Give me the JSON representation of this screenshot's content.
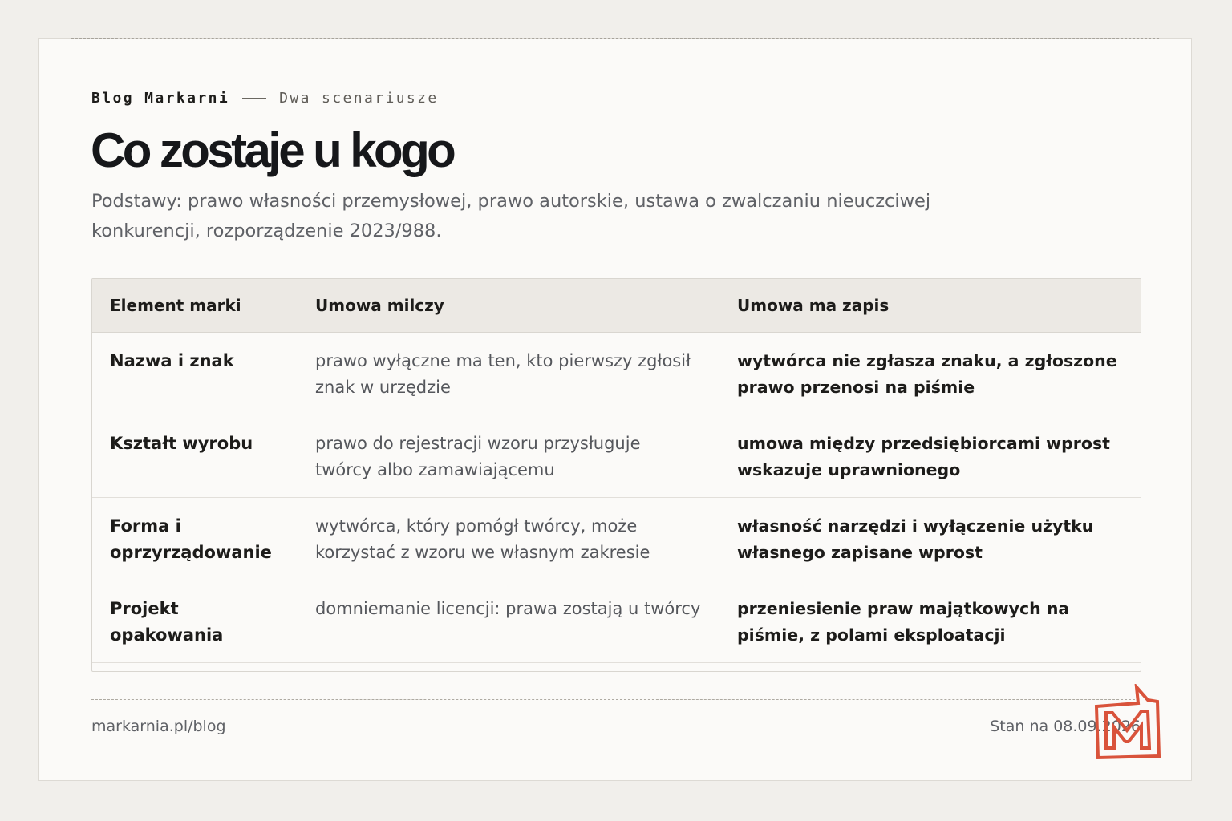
{
  "header": {
    "brand": "Blog Markarni",
    "section": "Dwa scenariusze",
    "title": "Co zostaje u kogo",
    "subtitle": "Podstawy: prawo własności przemysłowej, prawo autorskie, ustawa o zwalczaniu nieuczciwej konkurencji, rozporządzenie 2023/988."
  },
  "table": {
    "columns": [
      "Element marki",
      "Umowa milczy",
      "Umowa ma zapis"
    ],
    "rows": [
      {
        "element": "Nazwa i znak",
        "silent": "prawo wyłączne ma ten, kto pierwszy zgłosił znak w urzędzie",
        "clause": "wytwórca nie zgłasza znaku, a zgłoszone prawo przenosi na piśmie"
      },
      {
        "element": "Kształt wyrobu",
        "silent": "prawo do rejestracji wzoru przysługuje twórcy albo zamawiającemu",
        "clause": "umowa między przedsiębiorcami wprost wskazuje uprawnionego"
      },
      {
        "element": "Forma i oprzyrządowanie",
        "silent": "wytwórca, który pomógł twórcy, może korzystać z wzoru we własnym zakresie",
        "clause": "własność narzędzi i wyłączenie użytku własnego zapisane wprost"
      },
      {
        "element": "Projekt opakowania",
        "silent": "domniemanie licencji: prawa zostają u twórcy",
        "clause": "przeniesienie praw majątkowych na piśmie, z polami eksploatacji"
      }
    ]
  },
  "footer": {
    "url": "markarnia.pl/blog",
    "date": "Stan na 08.09.2026"
  },
  "logo": {
    "icon": "m-logo-icon",
    "color": "#d9533b"
  }
}
